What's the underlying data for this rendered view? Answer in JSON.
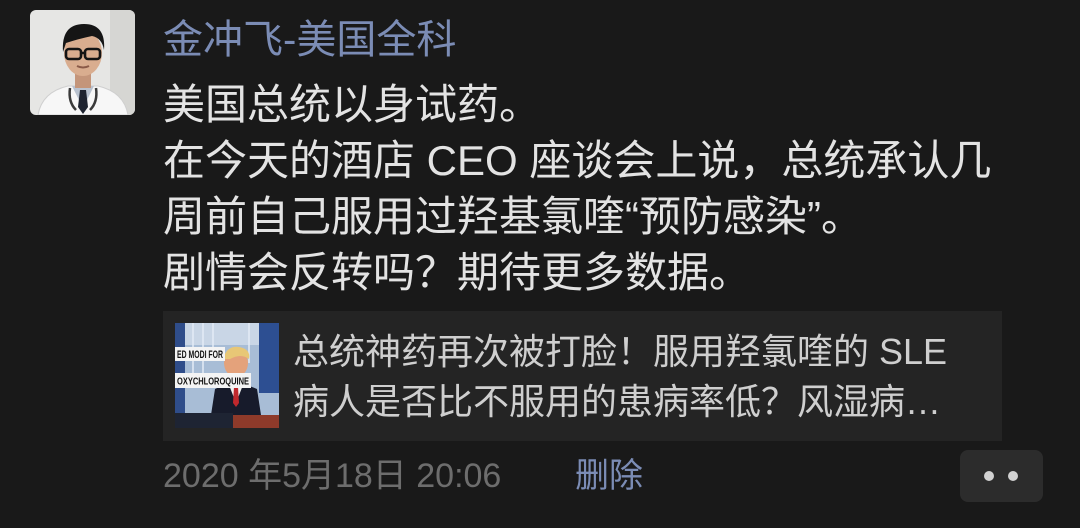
{
  "colors": {
    "background": "#191919",
    "text_primary": "#e3e3e3",
    "link_blue": "#7b8cb5",
    "card_background": "#242424",
    "card_text": "#cfcfcf",
    "meta_gray": "#6d6d6d",
    "button_background": "#2c2c2c"
  },
  "post": {
    "avatar": {
      "icon": "avatar-photo-icon"
    },
    "author_name": "金冲飞-美国全科",
    "text_lines": [
      "美国总统以身试药。",
      "在今天的酒店 CEO 座谈会上说，总统承认几",
      "周前自己服用过羟基氯喹“预防感染”。",
      "剧情会反转吗？期待更多数据。"
    ],
    "link_card": {
      "thumbnail": {
        "icon": "news-photo-thumbnail",
        "caption_lines": [
          "ED MODI FOR",
          "OXYCHLOROQUINE"
        ]
      },
      "title_lines": [
        "总统神药再次被打脸！服用羟氯喹的 SLE",
        "病人是否比不服用的患病率低？风湿病…"
      ]
    },
    "timestamp": "2020 年5月18日 20:06",
    "delete_label": "删除",
    "more_button": {
      "icon": "more-dots-icon"
    }
  }
}
